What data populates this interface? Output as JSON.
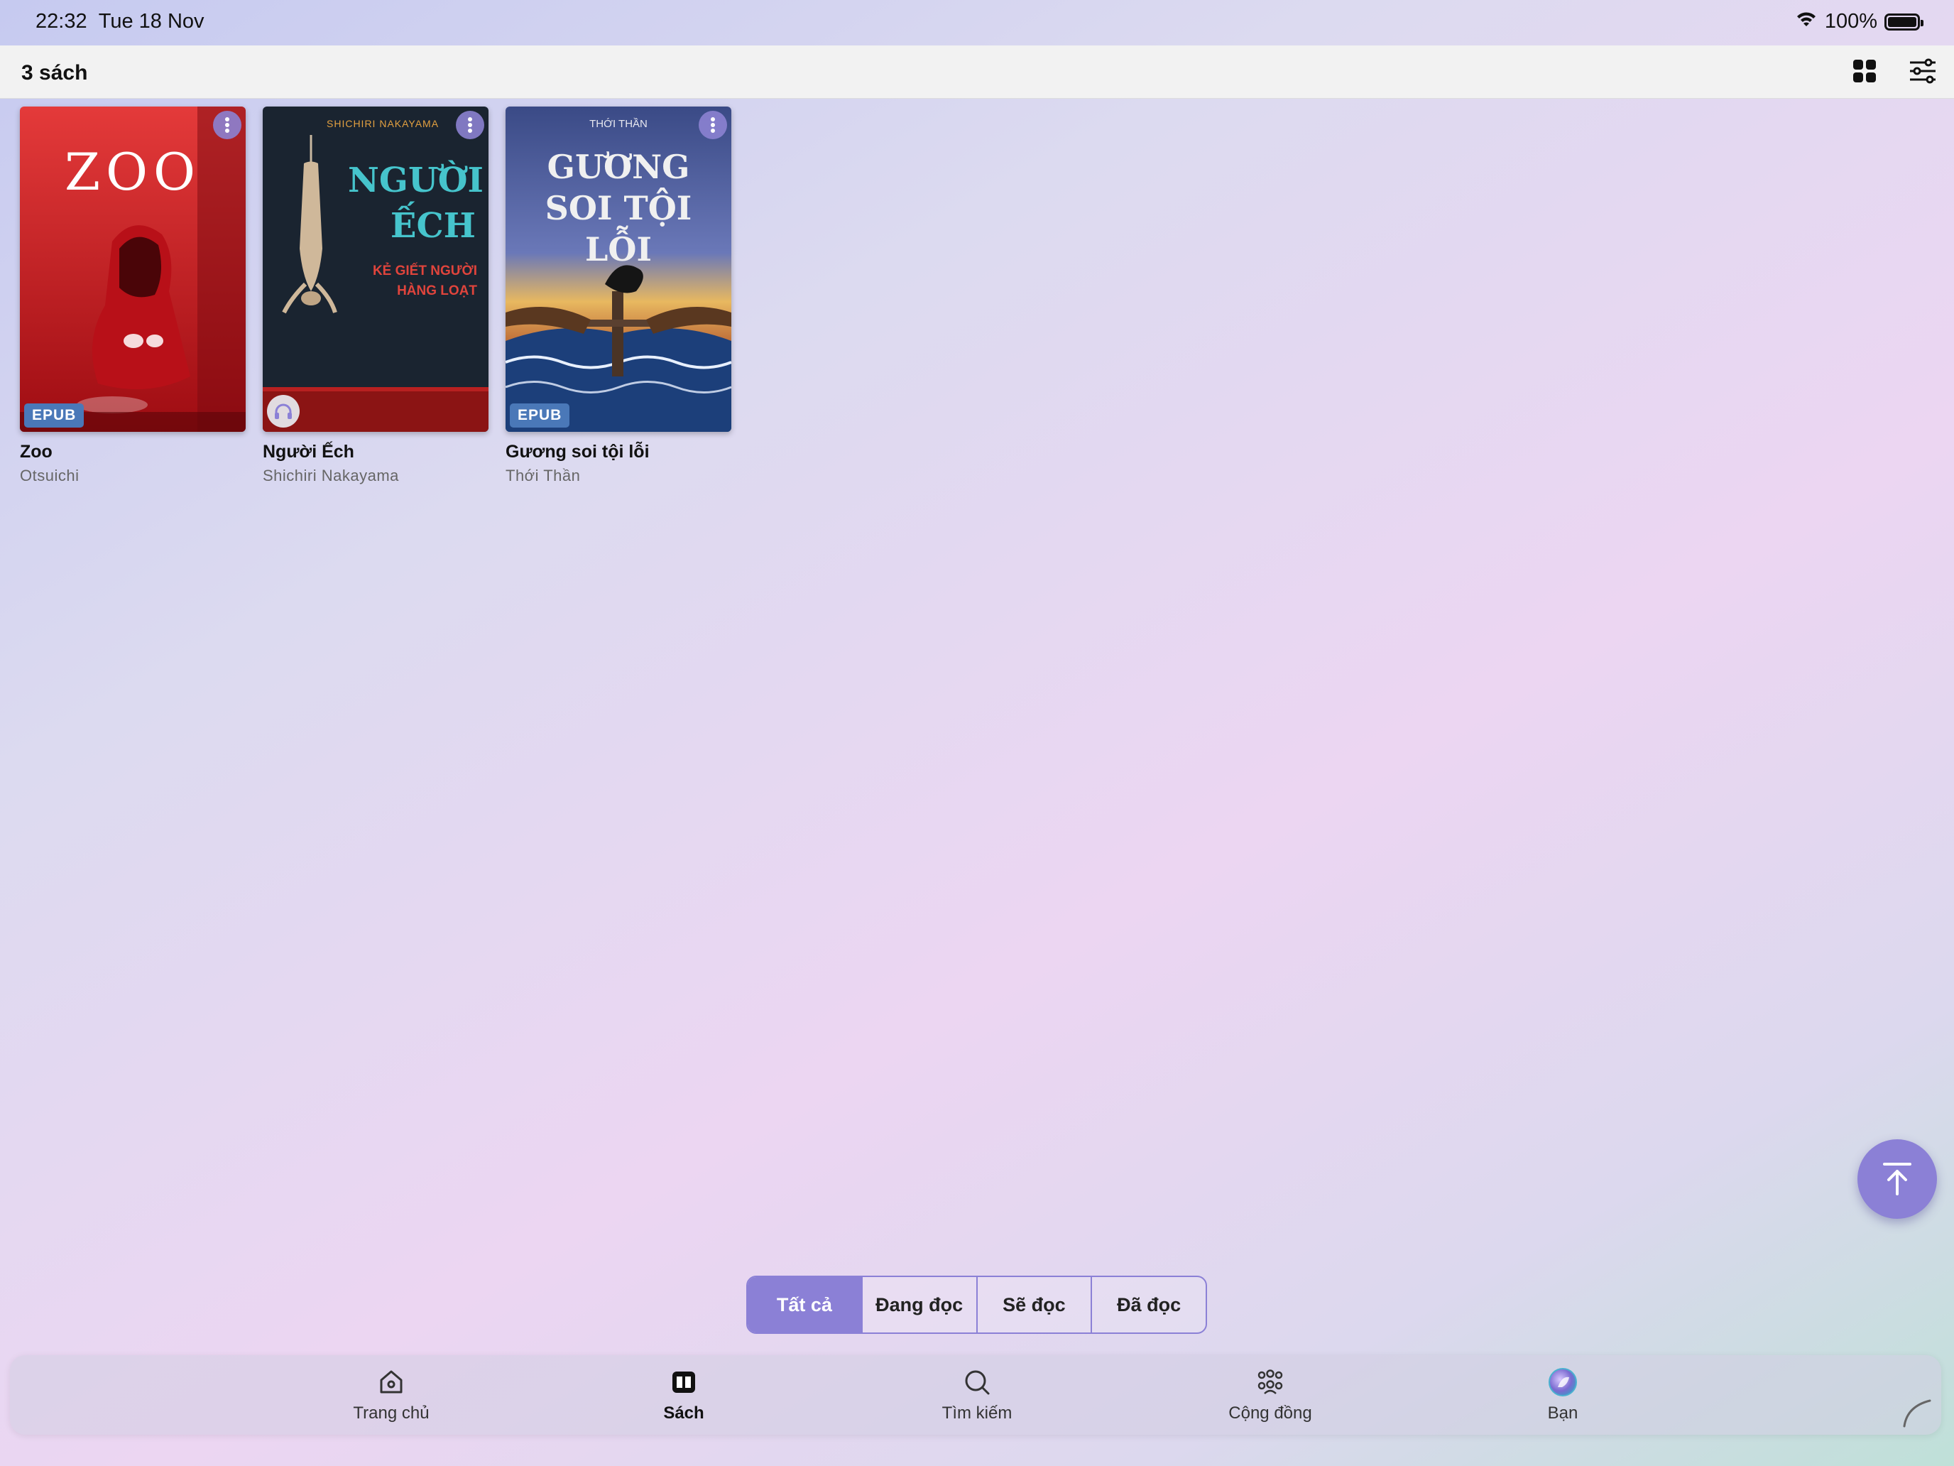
{
  "status": {
    "time": "22:32",
    "date": "Tue 18 Nov",
    "battery": "100%"
  },
  "header": {
    "count": "3 sách",
    "icons": [
      "grid-view-icon",
      "filter-sliders-icon"
    ]
  },
  "books": [
    {
      "title": "Zoo",
      "author": "Otsuichi",
      "badge": "EPUB",
      "cover_title": "ZOO"
    },
    {
      "title": "Người Ếch",
      "author": "Shichiri Nakayama",
      "badge_icon": "headphones-icon",
      "cover_title": "NGƯỜI ẾCH",
      "cover_subtitle": "KẺ GIẾT NGƯỜI HÀNG LOẠT",
      "cover_author": "SHICHIRI NAKAYAMA"
    },
    {
      "title": "Gương soi tội lỗi",
      "author": "Thới Thần",
      "badge": "EPUB",
      "cover_title": "GƯƠNG SOI TỘI LỖI",
      "cover_author": "THỚI THẦN"
    }
  ],
  "filters": [
    {
      "label": "Tất cả",
      "active": true
    },
    {
      "label": "Đang đọc"
    },
    {
      "label": "Sẽ đọc"
    },
    {
      "label": "Đã đọc"
    }
  ],
  "tabs": [
    {
      "label": "Trang chủ",
      "icon": "home-icon"
    },
    {
      "label": "Sách",
      "icon": "book-icon",
      "active": true
    },
    {
      "label": "Tìm kiếm",
      "icon": "search-icon"
    },
    {
      "label": "Cộng đồng",
      "icon": "community-icon"
    },
    {
      "label": "Bạn",
      "icon": "avatar-icon"
    }
  ],
  "colors": {
    "accent": "#8b80d6",
    "epub_badge": "#4a78b8"
  }
}
